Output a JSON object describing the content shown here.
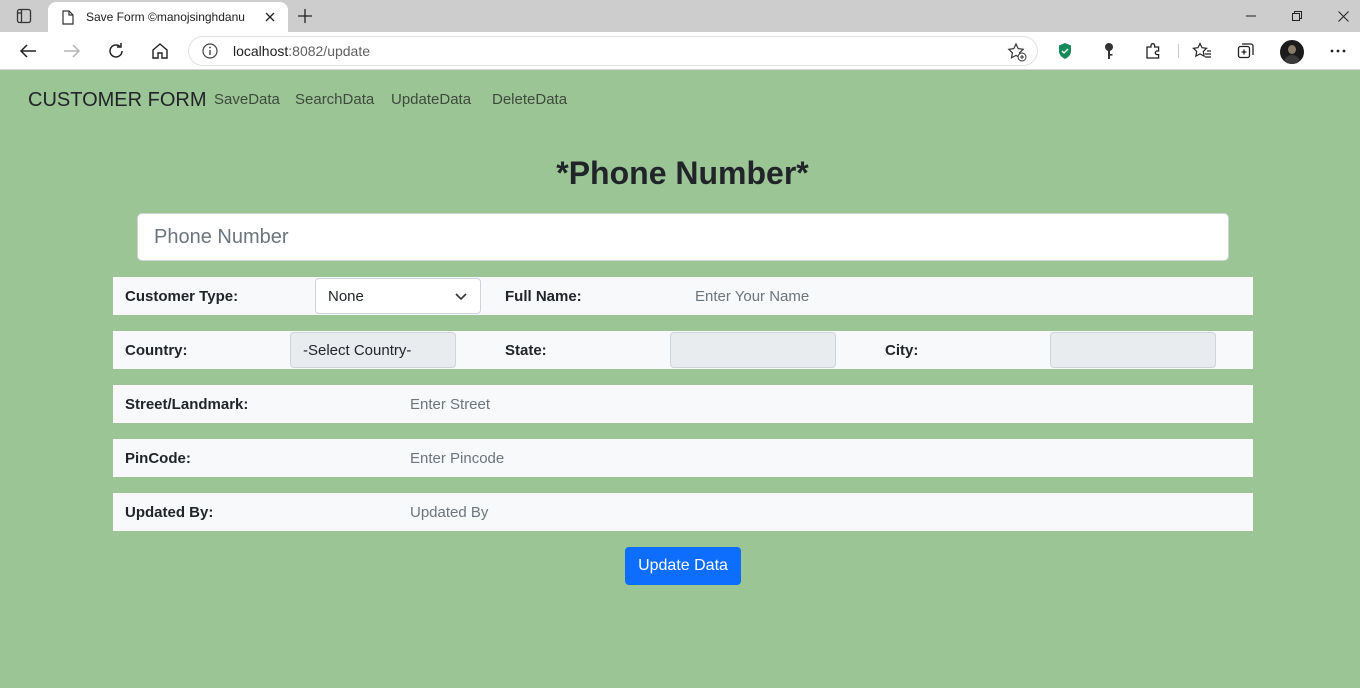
{
  "browser": {
    "tab_title": "Save Form ©manojsinghdanu",
    "url_host": "localhost",
    "url_rest": ":8082/update"
  },
  "navbar": {
    "brand": "CUSTOMER FORM",
    "links": [
      "SaveData",
      "SearchData",
      "UpdateData",
      "DeleteData"
    ]
  },
  "form": {
    "heading": "*Phone Number*",
    "phone_placeholder": "Phone Number",
    "customer_type_label": "Customer Type:",
    "customer_type_value": "None",
    "full_name_label": "Full Name:",
    "full_name_placeholder": "Enter Your Name",
    "country_label": "Country:",
    "country_value": "-Select Country-",
    "state_label": "State:",
    "state_value": "",
    "city_label": "City:",
    "city_value": "",
    "street_label": "Street/Landmark:",
    "street_placeholder": "Enter Street",
    "pincode_label": "PinCode:",
    "pincode_placeholder": "Enter Pincode",
    "updated_by_label": "Updated By:",
    "updated_by_placeholder": "Updated By",
    "submit_label": "Update Data"
  },
  "colors": {
    "page_background": "#9bc595",
    "button_primary": "#0d6efd"
  }
}
